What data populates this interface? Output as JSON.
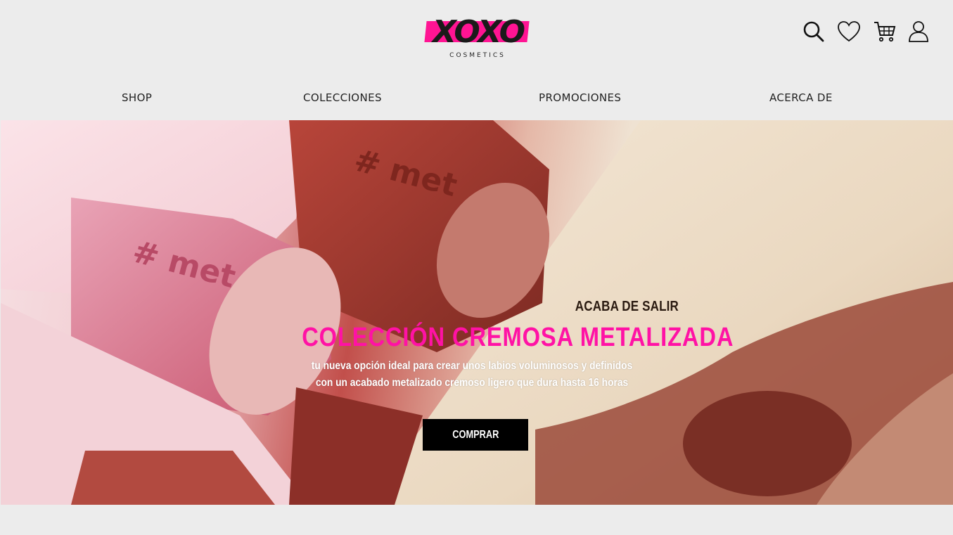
{
  "brand": {
    "logo_text": "XOXO",
    "logo_sub": "COSMETICS",
    "accent": "#ff1493"
  },
  "header": {
    "icons": [
      "search-icon",
      "heart-icon",
      "cart-icon",
      "user-icon"
    ]
  },
  "nav": {
    "items": [
      {
        "label": "SHOP"
      },
      {
        "label": "COLECCIONES"
      },
      {
        "label": "PROMOCIONES"
      },
      {
        "label": "ACERCA DE"
      }
    ]
  },
  "hero": {
    "eyebrow": "ACABA DE SALIR",
    "title": "COLECCIÓN CREMOSA METALIZADA",
    "description_line1": "tu nueva opción ideal para crear unos labios voluminosos y definidos",
    "description_line2": "con un acabado metalizado cremoso ligero que dura hasta 16 horas",
    "cta_label": "COMPRAR",
    "title_color": "#ff12a5",
    "image_embossed_text": "# met"
  }
}
